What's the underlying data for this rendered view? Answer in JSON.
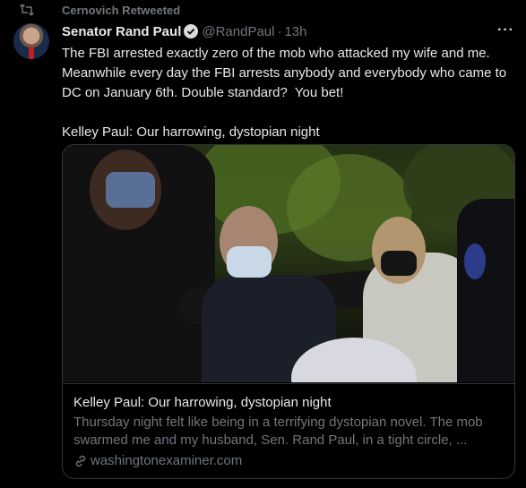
{
  "retweet": {
    "label": "Cernovich Retweeted",
    "icon": "retweet-icon"
  },
  "tweet": {
    "author_name": "Senator Rand Paul",
    "handle": "@RandPaul",
    "separator": "·",
    "time": "13h",
    "more": "···",
    "text": "The FBI arrested exactly zero of the mob who attacked my wife and me. Meanwhile every day the FBI arrests anybody and everybody who came to DC on January 6th. Double standard?  You bet!\n\nKelley Paul: Our harrowing, dystopian night"
  },
  "card": {
    "title": "Kelley Paul: Our harrowing, dystopian night",
    "description": "Thursday night felt like being in a terrifying dystopian novel. The mob swarmed me and my husband, Sen. Rand Paul, in a tight circle, ...",
    "domain": "washingtonexaminer.com"
  },
  "colors": {
    "background": "#000000",
    "primary_text": "#e7e9ea",
    "secondary_text": "#71767b",
    "border": "#333639"
  }
}
